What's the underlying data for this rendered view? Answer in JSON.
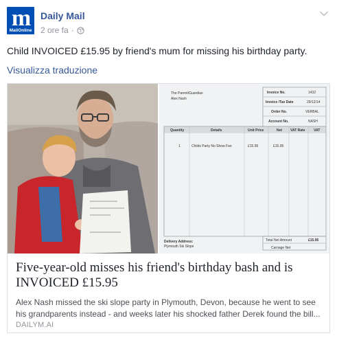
{
  "page": {
    "name": "Daily Mail",
    "avatar_letter": "m",
    "avatar_caption": "MailOnline"
  },
  "meta": {
    "time": "2 ore fa",
    "separator": "·",
    "audience_icon": "globe-icon"
  },
  "menu_icon": "chevron-down-icon",
  "post": {
    "text": "Child INVOICED £15.95 by friend's mum for missing his birthday party.",
    "translate_label": "Visualizza traduzione"
  },
  "card": {
    "title": "Five-year-old misses his friend's birthday bash and is INVOICED £15.95",
    "description": "Alex Nash missed the ski slope party in Plymouth, Devon, because he went to see his grandparents instead - and weeks later his shocked father Derek found the bill...",
    "domain": "DAILYM.AI"
  },
  "invoice": {
    "to_label": "The Parent/Guardian",
    "to_name": "Alex Nash",
    "fields": [
      {
        "label": "Invoice No.",
        "value": "1432"
      },
      {
        "label": "Invoice /Tax Date",
        "value": "29/12/14"
      },
      {
        "label": "Order No.",
        "value": "VERBAL"
      },
      {
        "label": "Account No.",
        "value": "NASH"
      }
    ],
    "columns": [
      "Quantity",
      "Details",
      "Unit Price",
      "Net",
      "VAT Rate",
      "VAT"
    ],
    "row": {
      "quantity": "1",
      "details": "Childs Party No Show Fee",
      "unit_price": "£15.95",
      "net": "£15.95"
    },
    "delivery_label": "Delivery Address:",
    "delivery_value": "Plymouth Ski Slope",
    "total_label": "Total Net Amount",
    "total_value": "£15.95",
    "carriage_label": "Carriage Net"
  },
  "colors": {
    "brand": "#004db3",
    "link": "#365899",
    "meta": "#90949c"
  }
}
